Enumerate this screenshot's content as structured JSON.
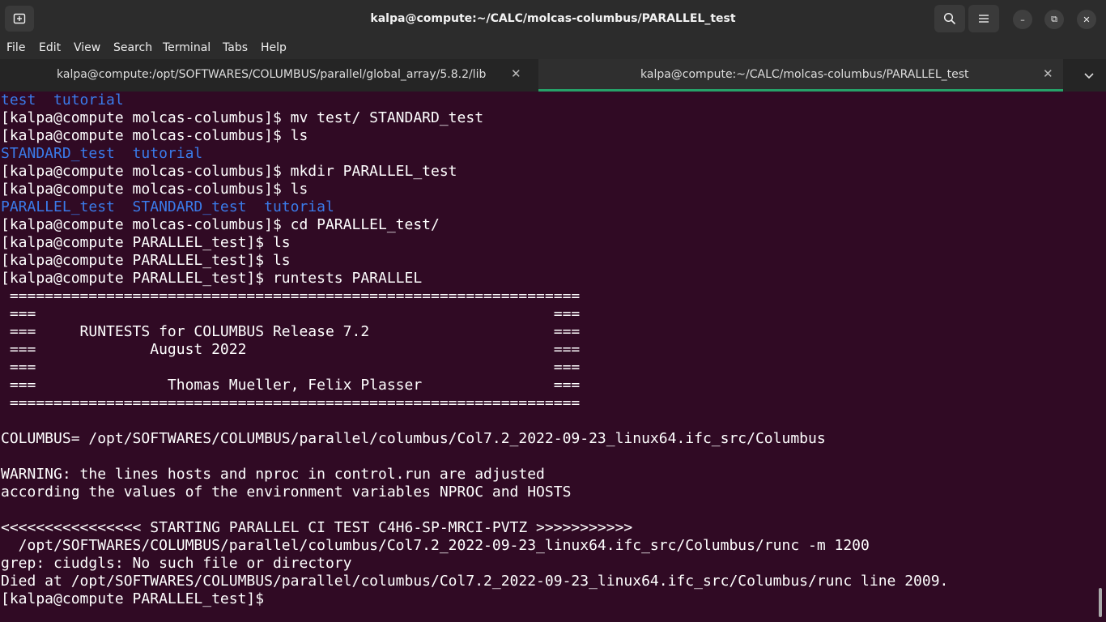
{
  "window": {
    "title": "kalpa@compute:~/CALC/molcas-columbus/PARALLEL_test",
    "controls": {
      "minimize": "–",
      "maximize": "⧉",
      "close": "✕"
    }
  },
  "menu": [
    "File",
    "Edit",
    "View",
    "Search",
    "Terminal",
    "Tabs",
    "Help"
  ],
  "tabs": [
    {
      "label": "kalpa@compute:/opt/SOFTWARES/COLUMBUS/parallel/global_array/5.8.2/lib",
      "active": false
    },
    {
      "label": "kalpa@compute:~/CALC/molcas-columbus/PARALLEL_test",
      "active": true
    }
  ],
  "tab_close_glyph": "✕",
  "colors": {
    "terminal_bg": "#300a24",
    "directory_blue": "#3a7bea",
    "active_tab_accent": "#26a269",
    "titlebar": "#2c2c2c"
  },
  "icons": {
    "new_tab": "new-tab-icon",
    "search": "search-icon",
    "menu": "hamburger-menu-icon",
    "tabs_dropdown": "chevron-down-icon"
  },
  "terminal": {
    "lines": [
      {
        "text": "test  tutorial",
        "color": "blue"
      },
      {
        "text": "[kalpa@compute molcas-columbus]$ mv test/ STANDARD_test",
        "color": "white"
      },
      {
        "text": "[kalpa@compute molcas-columbus]$ ls",
        "color": "white"
      },
      {
        "text": "STANDARD_test  tutorial",
        "color": "blue"
      },
      {
        "text": "[kalpa@compute molcas-columbus]$ mkdir PARALLEL_test",
        "color": "white"
      },
      {
        "text": "[kalpa@compute molcas-columbus]$ ls",
        "color": "white"
      },
      {
        "text": "PARALLEL_test  STANDARD_test  tutorial",
        "color": "blue"
      },
      {
        "text": "[kalpa@compute molcas-columbus]$ cd PARALLEL_test/",
        "color": "white"
      },
      {
        "text": "[kalpa@compute PARALLEL_test]$ ls",
        "color": "white"
      },
      {
        "text": "[kalpa@compute PARALLEL_test]$ ls",
        "color": "white"
      },
      {
        "text": "[kalpa@compute PARALLEL_test]$ runtests PARALLEL",
        "color": "white"
      },
      {
        "text": " =================================================================",
        "color": "white"
      },
      {
        "text": " ===                                                           ===",
        "color": "white"
      },
      {
        "text": " ===     RUNTESTS for COLUMBUS Release 7.2                     ===",
        "color": "white"
      },
      {
        "text": " ===             August 2022                                   ===",
        "color": "white"
      },
      {
        "text": " ===                                                           ===",
        "color": "white"
      },
      {
        "text": " ===               Thomas Mueller, Felix Plasser               ===",
        "color": "white"
      },
      {
        "text": " =================================================================",
        "color": "white"
      },
      {
        "text": "",
        "color": "white"
      },
      {
        "text": "COLUMBUS= /opt/SOFTWARES/COLUMBUS/parallel/columbus/Col7.2_2022-09-23_linux64.ifc_src/Columbus",
        "color": "white"
      },
      {
        "text": "",
        "color": "white"
      },
      {
        "text": "WARNING: the lines hosts and nproc in control.run are adjusted",
        "color": "white"
      },
      {
        "text": "according the values of the environment variables NPROC and HOSTS",
        "color": "white"
      },
      {
        "text": "",
        "color": "white"
      },
      {
        "text": "<<<<<<<<<<<<<<<< STARTING PARALLEL CI TEST C4H6-SP-MRCI-PVTZ >>>>>>>>>>>",
        "color": "white"
      },
      {
        "text": "  /opt/SOFTWARES/COLUMBUS/parallel/columbus/Col7.2_2022-09-23_linux64.ifc_src/Columbus/runc -m 1200",
        "color": "white"
      },
      {
        "text": "grep: ciudgls: No such file or directory",
        "color": "white"
      },
      {
        "text": "Died at /opt/SOFTWARES/COLUMBUS/parallel/columbus/Col7.2_2022-09-23_linux64.ifc_src/Columbus/runc line 2009.",
        "color": "white"
      },
      {
        "text": "[kalpa@compute PARALLEL_test]$ ",
        "color": "white"
      }
    ]
  }
}
